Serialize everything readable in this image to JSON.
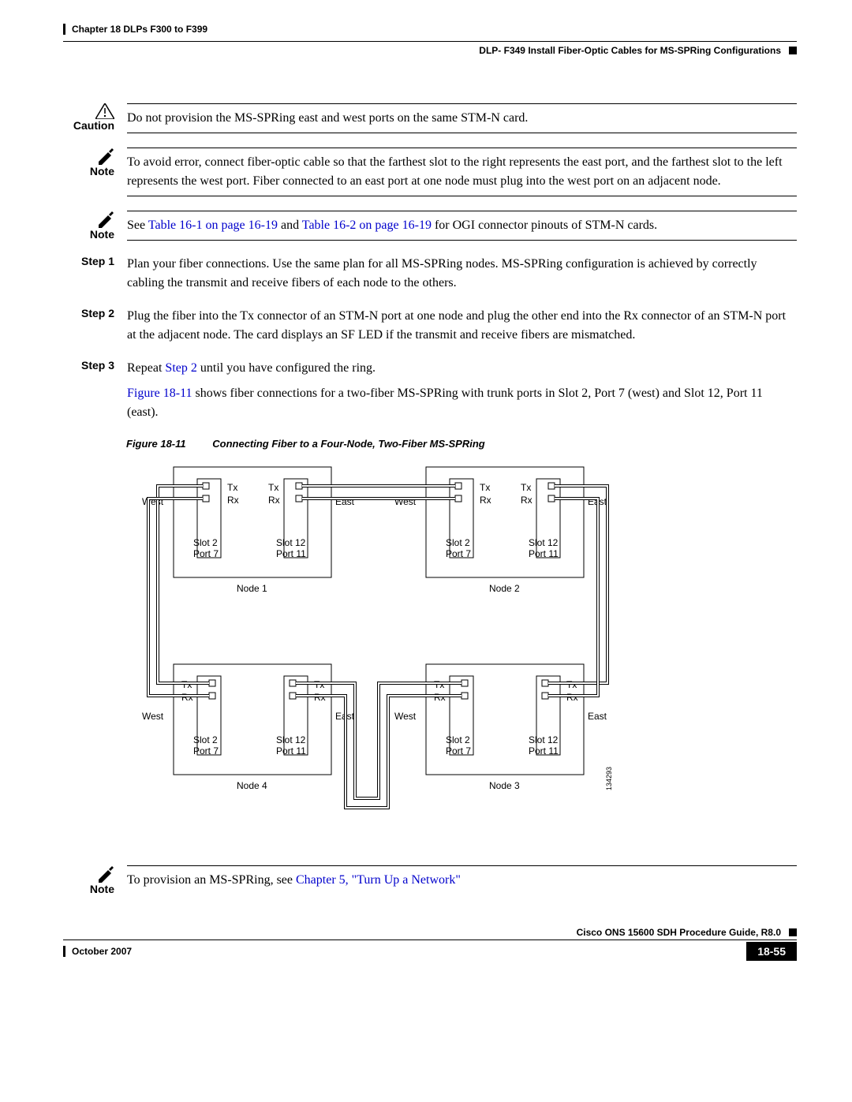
{
  "header": {
    "chapter": "Chapter 18 DLPs F300 to F399",
    "section": "DLP- F349 Install Fiber-Optic Cables for MS-SPRing Configurations"
  },
  "caution": {
    "label": "Caution",
    "text": "Do not provision the MS-SPRing east and west ports on the same STM-N card."
  },
  "note1": {
    "label": "Note",
    "text": "To avoid error, connect fiber-optic cable so that the farthest slot to the right represents the east port, and the farthest slot to the left represents the west port. Fiber connected to an east port at one node must plug into the west port on an adjacent node."
  },
  "note2": {
    "label": "Note",
    "prefix": "See ",
    "link1": "Table 16-1 on page 16-19",
    "mid": " and ",
    "link2": "Table 16-2 on page 16-19",
    "suffix": " for OGI connector pinouts of STM-N cards."
  },
  "steps": {
    "s1": {
      "label": "Step 1",
      "text": "Plan your fiber connections. Use the same plan for all MS-SPRing nodes. MS-SPRing configuration is achieved by correctly cabling the transmit and receive fibers of each node to the others."
    },
    "s2": {
      "label": "Step 2",
      "text": "Plug the fiber into the Tx connector of an STM-N port at one node and plug the other end into the Rx connector of an STM-N port at the adjacent node. The card displays an SF LED if the transmit and receive fibers are mismatched."
    },
    "s3": {
      "label": "Step 3",
      "prefix": "Repeat ",
      "link": "Step 2",
      "suffix": " until you have configured the ring."
    },
    "s3extra": {
      "link": "Figure 18-11",
      "text": " shows fiber connections for a two-fiber MS-SPRing with trunk ports in Slot 2, Port 7 (west) and Slot 12, Port 11 (east)."
    }
  },
  "figure": {
    "num": "Figure 18-11",
    "title": "Connecting Fiber to a Four-Node, Two-Fiber MS-SPRing",
    "labels": {
      "tx": "Tx",
      "rx": "Rx",
      "west": "West",
      "east": "East",
      "slot2": "Slot 2",
      "port7": "Port 7",
      "slot12": "Slot 12",
      "port11": "Port 11",
      "node1": "Node 1",
      "node2": "Node 2",
      "node3": "Node 3",
      "node4": "Node 4",
      "imgid": "134293"
    }
  },
  "note3": {
    "label": "Note",
    "prefix": "To provision an MS-SPRing, see ",
    "link": "Chapter 5, \"Turn Up a Network\""
  },
  "footer": {
    "guide": "Cisco ONS 15600 SDH Procedure Guide, R8.0",
    "date": "October 2007",
    "page": "18-55"
  }
}
